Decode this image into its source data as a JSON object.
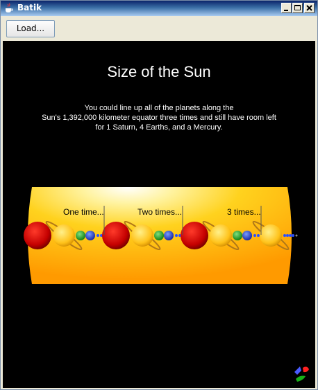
{
  "window": {
    "title": "Batik"
  },
  "toolbar": {
    "load_label": "Load..."
  },
  "document": {
    "heading": "Size of the Sun",
    "blurb_lines": [
      "You could line up all of the planets along the",
      "Sun's 1,392,000 kilometer equator three times and still have room left",
      "for 1 Saturn, 4 Earths, and a Mercury."
    ],
    "labels": [
      "One time...",
      "Two times...",
      "3 times..."
    ]
  },
  "colors": {
    "canvas": "#000000",
    "sun_core": "#ffffff",
    "sun_mid": "#ffd21e",
    "sun_edge": "#ff9a00",
    "jupiter": "#c40000",
    "saturn": "#ffc21a",
    "uranus": "#1aa31a",
    "neptune": "#1f3fe0"
  }
}
